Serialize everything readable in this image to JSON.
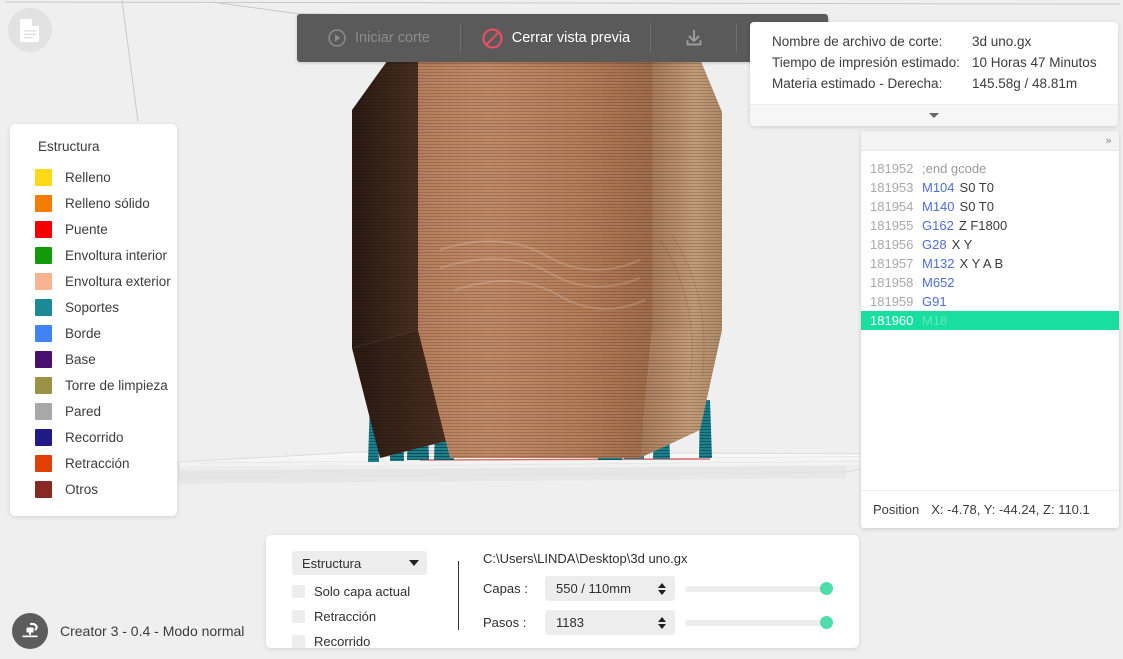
{
  "window": {
    "doc_icon": "document-icon"
  },
  "toolbar": {
    "start_slice_label": "Iniciar corte",
    "start_slice_icon": "play-circle-icon",
    "close_preview_label": "Cerrar vista previa",
    "close_preview_icon": "prohibition-icon",
    "save_icon": "download-icon",
    "slice_icon": "slice-layers-icon"
  },
  "info_panel": {
    "rows": [
      {
        "key": "Nombre de archivo de corte:",
        "value": "3d uno.gx"
      },
      {
        "key": "Tiempo de impresión estimado:",
        "value": "10 Horas 47 Minutos"
      },
      {
        "key": "Materia estimado - Derecha:",
        "value": "145.58g / 48.81m"
      }
    ],
    "collapse_icon": "chevron-down-icon"
  },
  "gcode_panel": {
    "expand_label": "»",
    "lines": [
      {
        "num": "181952",
        "cmd": "",
        "args": "",
        "comment": ";end gcode",
        "selected": false
      },
      {
        "num": "181953",
        "cmd": "M104",
        "args": "S0 T0",
        "comment": "",
        "selected": false
      },
      {
        "num": "181954",
        "cmd": "M140",
        "args": "S0 T0",
        "comment": "",
        "selected": false
      },
      {
        "num": "181955",
        "cmd": "G162",
        "args": "Z F1800",
        "comment": "",
        "selected": false
      },
      {
        "num": "181956",
        "cmd": "G28",
        "args": "X Y",
        "comment": "",
        "selected": false
      },
      {
        "num": "181957",
        "cmd": "M132",
        "args": "X Y A B",
        "comment": "",
        "selected": false
      },
      {
        "num": "181958",
        "cmd": "M652",
        "args": "",
        "comment": "",
        "selected": false
      },
      {
        "num": "181959",
        "cmd": "G91",
        "args": "",
        "comment": "",
        "selected": false
      },
      {
        "num": "181960",
        "cmd": "M18",
        "args": "",
        "comment": "",
        "selected": true
      }
    ],
    "position_label": "Position",
    "position_value": "X: -4.78, Y: -44.24, Z: 110.1"
  },
  "legend": {
    "title": "Estructura",
    "items": [
      {
        "label": "Relleno",
        "color": "#ffd918"
      },
      {
        "label": "Relleno sólido",
        "color": "#f57c00"
      },
      {
        "label": "Puente",
        "color": "#f40000"
      },
      {
        "label": "Envoltura interior",
        "color": "#139a0b"
      },
      {
        "label": "Envoltura exterior",
        "color": "#f8b490"
      },
      {
        "label": "Soportes",
        "color": "#1b8a96"
      },
      {
        "label": "Borde",
        "color": "#4083f5"
      },
      {
        "label": "Base",
        "color": "#4a1070"
      },
      {
        "label": "Torre de limpieza",
        "color": "#9b9246"
      },
      {
        "label": "Pared",
        "color": "#a8a8a8"
      },
      {
        "label": "Recorrido",
        "color": "#201a86"
      },
      {
        "label": "Retracción",
        "color": "#e04008"
      },
      {
        "label": "Otros",
        "color": "#8a2823"
      }
    ]
  },
  "bottom_panel": {
    "view_mode": "Estructura",
    "view_mode_arrow": "chevron-down-icon",
    "checkboxes": [
      {
        "label": "Solo capa actual",
        "checked": false
      },
      {
        "label": "Retracción",
        "checked": false
      },
      {
        "label": "Recorrido",
        "checked": false
      }
    ],
    "file_path": "C:\\Users\\LINDA\\Desktop\\3d uno.gx",
    "fields": [
      {
        "label": "Capas :",
        "value": "550 / 110mm",
        "slider_pct": 100
      },
      {
        "label": "Pasos :",
        "value": "1183",
        "slider_pct": 100
      }
    ]
  },
  "status": {
    "printer_icon": "printer-nozzle-icon",
    "text": "Creator 3 - 0.4 - Modo normal"
  },
  "colors": {
    "accent_green": "#18dfa0",
    "toolbar_bg": "#5a5a5a",
    "slider_knob": "#4fdcab",
    "gcode_cmd_blue": "#4f6ed6"
  }
}
